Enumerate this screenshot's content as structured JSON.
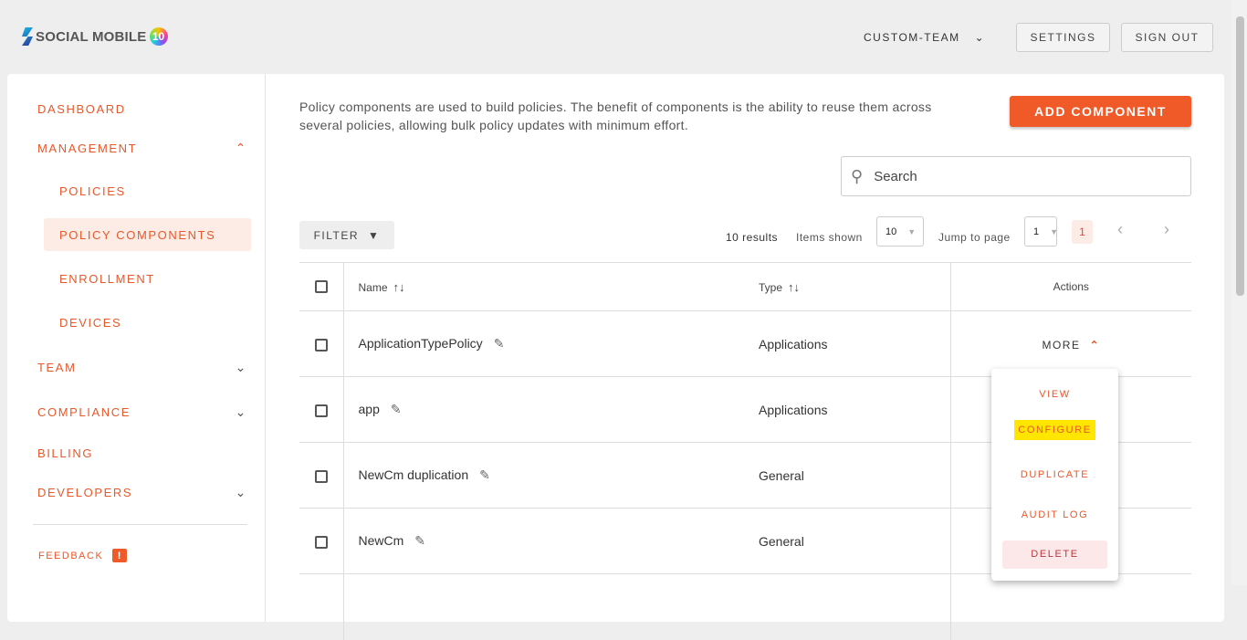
{
  "header": {
    "logo_text": "SOCIAL MOBILE",
    "logo_badge": "10",
    "team": "CUSTOM-TEAM",
    "settings": "SETTINGS",
    "signout": "SIGN OUT"
  },
  "sidebar": {
    "items": [
      {
        "label": "DASHBOARD"
      },
      {
        "label": "MANAGEMENT"
      },
      {
        "label": "POLICIES"
      },
      {
        "label": "POLICY COMPONENTS"
      },
      {
        "label": "ENROLLMENT"
      },
      {
        "label": "DEVICES"
      },
      {
        "label": "TEAM"
      },
      {
        "label": "COMPLIANCE"
      },
      {
        "label": "BILLING"
      },
      {
        "label": "DEVELOPERS"
      }
    ],
    "feedback": "FEEDBACK"
  },
  "main": {
    "description": "Policy components are used to build policies. The benefit of components is the ability to reuse them across several policies, allowing bulk policy updates with minimum effort.",
    "add_button": "ADD COMPONENT",
    "search_placeholder": "Search",
    "filter": "FILTER",
    "pagination": {
      "results": "10 results",
      "items_shown_label": "Items shown",
      "items_shown": "10",
      "jump_label": "Jump to page",
      "jump_value": "1",
      "current_page": "1"
    },
    "table": {
      "headers": [
        "Name",
        "Type",
        "Actions"
      ],
      "rows": [
        {
          "name": "ApplicationTypePolicy",
          "type": "Applications"
        },
        {
          "name": "app",
          "type": "Applications"
        },
        {
          "name": "NewCm duplication",
          "type": "General"
        },
        {
          "name": "NewCm",
          "type": "General"
        }
      ],
      "more": "MORE"
    },
    "menu": [
      "VIEW",
      "CONFIGURE",
      "DUPLICATE",
      "AUDIT LOG",
      "DELETE"
    ]
  },
  "colors": {
    "accent": "#f05a28",
    "highlight": "#ffe600"
  }
}
